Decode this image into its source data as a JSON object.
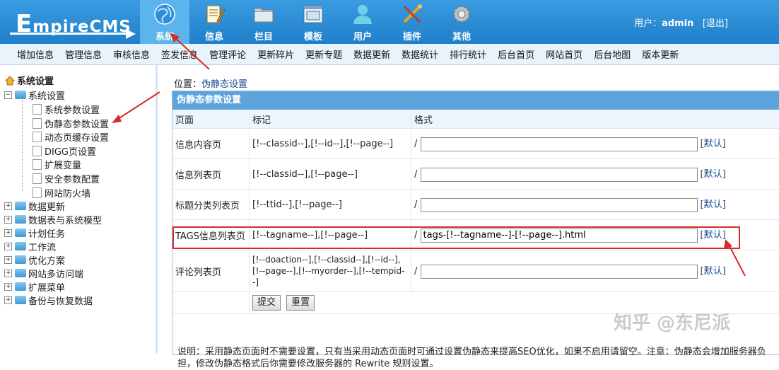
{
  "logo": {
    "brand_rest": "mpireCMS",
    "brand_first": "E"
  },
  "nav": [
    {
      "label": "系统",
      "icon": "globe-icon",
      "active": true
    },
    {
      "label": "信息",
      "icon": "notepad-icon"
    },
    {
      "label": "栏目",
      "icon": "folder-icon"
    },
    {
      "label": "模板",
      "icon": "window-icon"
    },
    {
      "label": "用户",
      "icon": "user-icon"
    },
    {
      "label": "插件",
      "icon": "tools-icon"
    },
    {
      "label": "其他",
      "icon": "gear-icon"
    }
  ],
  "user": {
    "prefix": "用户：",
    "name": "admin",
    "logout": "[退出]"
  },
  "subnav": [
    "增加信息",
    "管理信息",
    "审核信息",
    "签发信息",
    "管理评论",
    "更新碎片",
    "更新专题",
    "数据更新",
    "数据统计",
    "排行统计",
    "后台首页",
    "网站首页",
    "后台地图",
    "版本更新"
  ],
  "tree": {
    "root": "系统设置",
    "group": "系统设置",
    "children": [
      "系统参数设置",
      "伪静态参数设置",
      "动态页缓存设置",
      "DIGG页设置",
      "扩展变量",
      "安全参数配置",
      "网站防火墙"
    ],
    "folders": [
      "数据更新",
      "数据表与系统模型",
      "计划任务",
      "工作流",
      "优化方案",
      "网站多访问端",
      "扩展菜单",
      "备份与恢复数据"
    ]
  },
  "position": {
    "label": "位置：",
    "link": "伪静态设置"
  },
  "panel": {
    "title": "伪静态参数设置",
    "headers": [
      "页面",
      "标记",
      "格式"
    ],
    "rows": [
      {
        "page": "信息内容页",
        "tags": "[!--classid--],[!--id--],[!--page--]",
        "slash": "/",
        "value": "",
        "default": "[默认]"
      },
      {
        "page": "信息列表页",
        "tags": "[!--classid--],[!--page--]",
        "slash": "/",
        "value": "",
        "default": "[默认]"
      },
      {
        "page": "标题分类列表页",
        "tags": "[!--ttid--],[!--page--]",
        "slash": "/",
        "value": "",
        "default": "[默认]"
      },
      {
        "page": "TAGS信息列表页",
        "tags": "[!--tagname--],[!--page--]",
        "slash": "/",
        "value": "tags-[!--tagname--]-[!--page--].html",
        "default": "[默认]"
      },
      {
        "page": "评论列表页",
        "tags": "[!--doaction--],[!--classid--],[!--id--],[!--page--],[!--myorder--],[!--tempid--]",
        "slash": "/",
        "value": "",
        "default": "[默认]"
      }
    ],
    "submit": "提交",
    "reset": "重置",
    "note": "说明：采用静态页面时不需要设置，只有当采用动态页面时可通过设置伪静态来提高SEO优化，如果不启用请留空。注意：伪静态会增加服务器负担，修改伪静态格式后你需要修改服务器的 Rewrite 规则设置。"
  },
  "watermark": "知乎 @东尼派",
  "colors": {
    "topbar": "#1f7fca",
    "panel_title": "#5fa3db",
    "highlight": "#d62b2b"
  }
}
